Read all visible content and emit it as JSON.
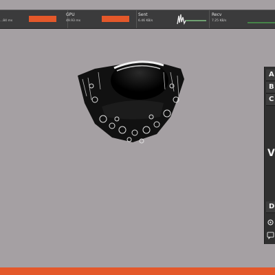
{
  "stats": [
    {
      "label": "",
      "value": "...84 ms"
    },
    {
      "label": "GPU",
      "value": "49.93 ms"
    },
    {
      "label": "Sent",
      "value": "6.46 KB/s"
    },
    {
      "label": "Recv",
      "value": "7.25 KB/s"
    }
  ],
  "side_panel": {
    "rows": [
      "A",
      "B",
      "C"
    ],
    "vertical_char": "V",
    "lower_row": "D"
  },
  "colors": {
    "accent": "#e4582a",
    "background": "#a5a0a3",
    "panel": "#2f2f2f",
    "graph_line": "#4caf50"
  }
}
